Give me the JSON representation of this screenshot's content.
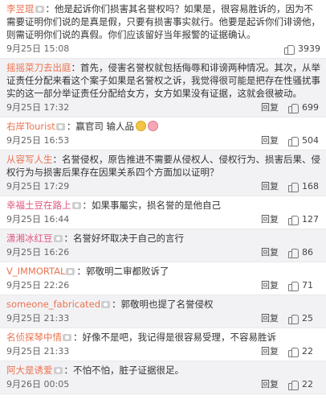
{
  "comments": [
    {
      "user": "李昱琨",
      "verified": true,
      "text": "他是起诉你们损害其名誉权吗？如果是，很容易胜诉的，因为不需要证明你们说的是真是假，只要有损害事实就行。他要是起诉你们诽谤他，则需证明你们说的真假。你们应该留好当年报警的证据确认。",
      "time": "9月25日 15:08",
      "reply": "",
      "likes": "3939"
    },
    {
      "user": "摇摇菜刀去出庭",
      "verified": false,
      "text": "首先，侵害名誉权就包括侮辱和诽谤两种情况。其次，从举证责任分配来看这个案子如果是名誉权之诉，我觉得很可能是把存在性骚扰事实的这一部分举证责任分配给女方，女方如果没有证据，这就会很被动。",
      "time": "9月25日 17:32",
      "reply": "回复",
      "likes": "699"
    },
    {
      "user": "右岸Tourist",
      "verified": true,
      "text": "赢官司 输人品",
      "emoji": [
        "face",
        "pig"
      ],
      "time": "9月25日 16:53",
      "reply": "回复",
      "likes": "504"
    },
    {
      "user": "从容写人生",
      "verified": false,
      "text": "名誉侵权，原告推进不需要从侵权人、侵权行为、损害后果、侵权行为与损害后果存在因果关系四个方面加以证明？",
      "time": "9月25日 17:29",
      "reply": "回复",
      "likes": "168"
    },
    {
      "user": "幸福土豆在路上",
      "verified": true,
      "text": "如果事屬实，损名誉的是他自己",
      "time": "9月25日 16:44",
      "reply": "回复",
      "likes": "127"
    },
    {
      "user": "潇湘冰红豆",
      "verified": true,
      "text": "名誉好坏取决于自己的言行",
      "time": "9月25日 16:26",
      "reply": "回复",
      "likes": "86"
    },
    {
      "user": "V_IMMORTAL",
      "verified": true,
      "text": "郭敬明二审都败诉了",
      "time": "9月25日 22:26",
      "reply": "回复",
      "likes": "71"
    },
    {
      "user": "someone_fabricated",
      "verified": true,
      "text": "郭敬明也提了名誉侵权",
      "time": "9月25日 21:33",
      "reply": "回复",
      "likes": "25"
    },
    {
      "user": "名侦探琴中情",
      "verified": true,
      "text": "好像不是吧，我记得是很容易受理，不容易胜诉",
      "time": "9月25日 21:33",
      "reply": "回复",
      "likes": "22"
    },
    {
      "user": "阿大是诱爱",
      "verified": true,
      "text": "不怕不怕，脏子证据很足。",
      "time": "9月26日 00:05",
      "reply": "回复",
      "likes": "22"
    }
  ]
}
